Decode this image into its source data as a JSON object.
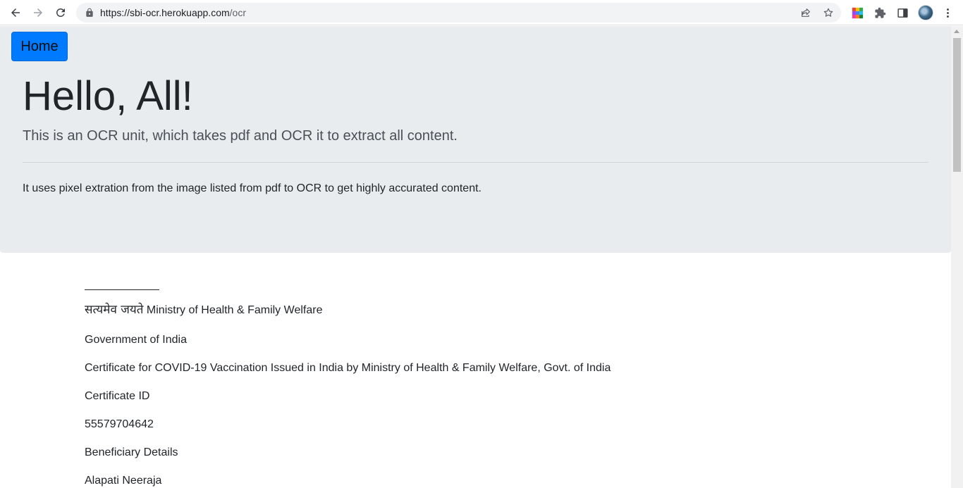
{
  "browser": {
    "url_host": "https://sbi-ocr.herokuapp.com",
    "url_path": "/ocr"
  },
  "icons": {
    "back": "back-arrow-icon",
    "forward": "forward-arrow-icon",
    "reload": "reload-icon",
    "lock": "lock-icon",
    "share": "share-icon",
    "bookmark": "star-icon",
    "extension_color": "color-extension-icon",
    "extensions": "puzzle-icon",
    "side_panel": "side-panel-icon",
    "profile": "avatar",
    "menu": "kebab-menu-icon"
  },
  "colors": {
    "jumbotron_bg": "#e9ecef",
    "primary": "#007bff"
  },
  "page": {
    "home_button": "Home",
    "title": "Hello, All!",
    "lead": "This is an OCR unit, which takes pdf and OCR it to extract all content.",
    "description": "It uses pixel extration from the image listed from pdf to OCR to get highly accurated content."
  },
  "ocr_content": {
    "line_1_hindi": "सत्यमेव जयते",
    "line_1_rest": " Ministry of Health & Family Welfare",
    "line_2": "Government of India",
    "line_3": "Certificate for COVID-19 Vaccination Issued in India by Ministry of Health & Family Welfare, Govt. of India",
    "line_4": "Certificate ID",
    "line_5": "55579704642",
    "line_6": "Beneficiary Details",
    "line_7": "Alapati Neeraja"
  }
}
